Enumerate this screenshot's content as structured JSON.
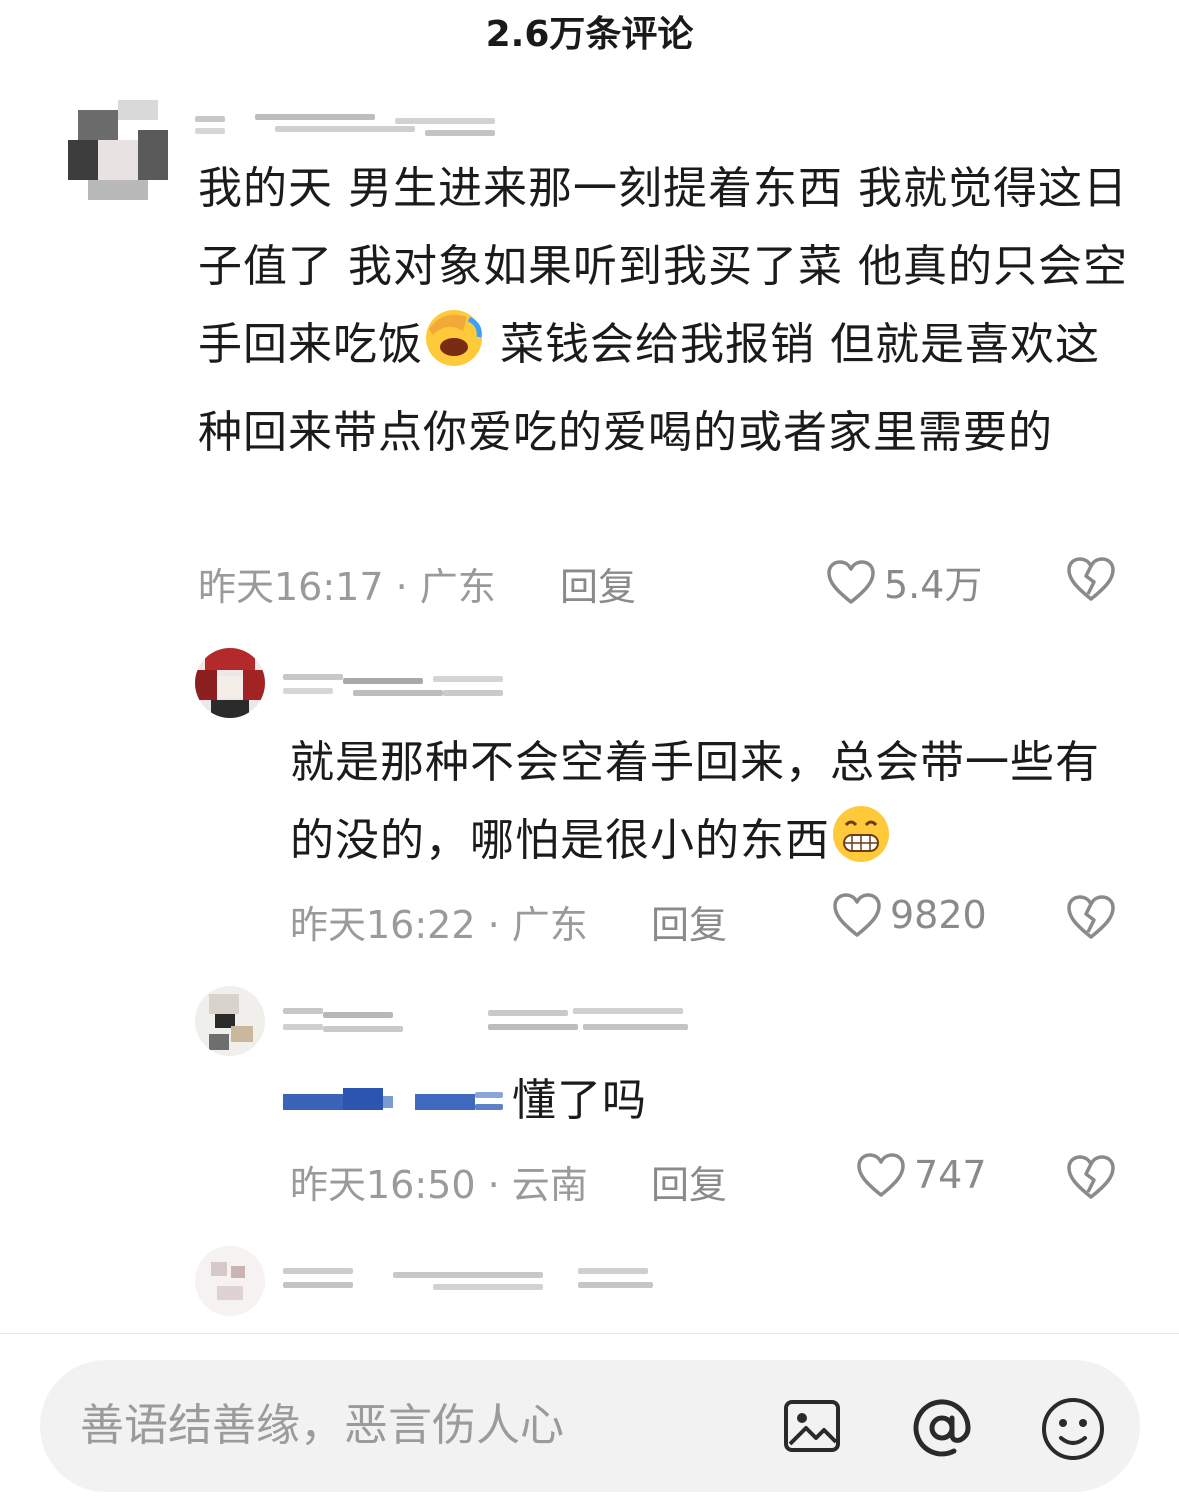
{
  "header": {
    "title": "2.6万条评论"
  },
  "comments": [
    {
      "text": "我的天 男生进来那一刻提着东西 我就觉得这日子值了 我对象如果听到我买了菜 他真的只会空手回来吃饭",
      "text_after_emoji": " 菜钱会给我报销 但就是喜欢这种回来带点你爱吃的爱喝的或者家里需要的",
      "emoji_icon": "facepalm-laugh-emoji",
      "time": "昨天16:17 · 广东",
      "reply_label": "回复",
      "likes": "5.4万"
    },
    {
      "text": "就是那种不会空着手回来，总会带一些有的没的，哪怕是很小的东西",
      "emoji_icon": "grinning-emoji",
      "time": "昨天16:22 · 广东",
      "reply_label": "回复",
      "likes": "9820"
    },
    {
      "text": "懂了吗",
      "time": "昨天16:50 · 云南",
      "reply_label": "回复",
      "likes": "747"
    }
  ],
  "input": {
    "placeholder": "善语结善缘，恶言伤人心",
    "icons": [
      "image-icon",
      "at-icon",
      "emoji-icon"
    ]
  },
  "colors": {
    "meta": "#9a9a9a",
    "inputbar": "#f2f2f2"
  }
}
